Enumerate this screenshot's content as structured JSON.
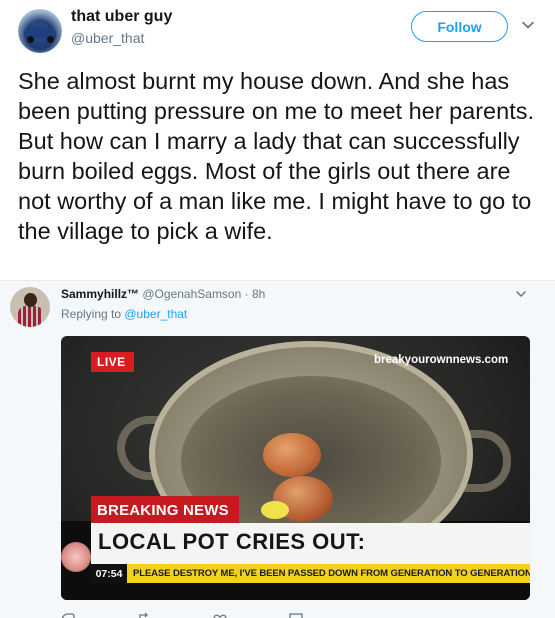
{
  "tweet": {
    "name": "that uber guy",
    "handle": "@uber_that",
    "follow_label": "Follow",
    "text": "She almost burnt my house down. And she has been putting pressure on me to meet her parents. But how can I marry a lady that can successfully burn boiled eggs. Most of the girls out there are not worthy of a man like me. I might have to go to the village to pick a wife."
  },
  "reply": {
    "name": "Sammyhillz™",
    "handle": "@OgenahSamson",
    "time": " · 8h",
    "replying_prefix": "Replying to ",
    "replying_handle": "@uber_that"
  },
  "news_image": {
    "live_label": "LIVE",
    "source": "breakyourownnews.com",
    "breaking_label": "BREAKING NEWS",
    "headline": "LOCAL POT CRIES OUT:",
    "ticker_time": "07:54",
    "ticker_text": "PLEASE DESTROY ME, I'VE BEEN PASSED DOWN FROM GENERATION TO GENERATION",
    "ticker_emoji": "😭😭"
  },
  "colors": {
    "accent": "#1da1f2",
    "live_red": "#d71c22",
    "ticker_yellow": "#f2d21e"
  },
  "icons": [
    "chevron-down-icon",
    "reply-icon",
    "retweet-icon",
    "like-icon",
    "message-icon"
  ]
}
